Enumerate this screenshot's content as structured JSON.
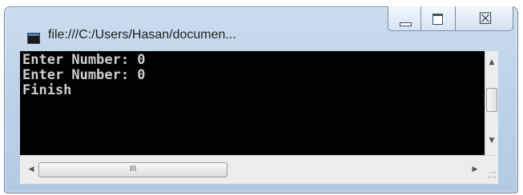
{
  "window": {
    "title": "file:///C:/Users/Hasan/documen...",
    "icon": "console-app-icon",
    "buttons": {
      "minimize": "minimize-icon",
      "maximize": "maximize-icon",
      "close": "close-icon"
    }
  },
  "console": {
    "lines": [
      "Enter Number: 0",
      "Enter Number: 0",
      "Finish"
    ],
    "background": "#000000",
    "foreground": "#cfcfcf"
  },
  "scrollbars": {
    "vertical": {
      "up": "▲",
      "down": "▼"
    },
    "horizontal": {
      "left": "◀",
      "right": "▶",
      "grip": "III"
    }
  }
}
